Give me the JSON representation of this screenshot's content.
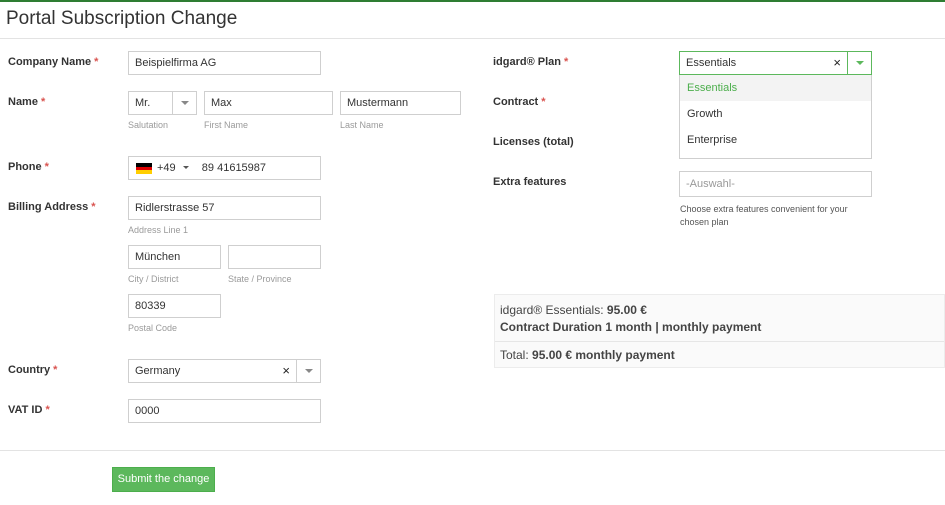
{
  "page": {
    "title": "Portal Subscription Change"
  },
  "required_marker": "*",
  "company": {
    "label": "Company Name",
    "value": "Beispielfirma AG"
  },
  "name": {
    "label": "Name",
    "salutation": "Mr.",
    "salutation_hint": "Salutation",
    "first_name": "Max",
    "first_name_hint": "First Name",
    "last_name": "Mustermann",
    "last_name_hint": "Last Name"
  },
  "phone": {
    "label": "Phone",
    "country_code": "+49",
    "number": "89 41615987"
  },
  "billing": {
    "label": "Billing Address",
    "address_line1": "Ridlerstrasse 57",
    "address_line1_hint": "Address Line 1",
    "city": "München",
    "city_hint": "City / District",
    "state": "",
    "state_hint": "State / Province",
    "postal_code": "80339",
    "postal_code_hint": "Postal Code"
  },
  "country": {
    "label": "Country",
    "value": "Germany"
  },
  "vat": {
    "label": "VAT ID",
    "value": "0000"
  },
  "plan": {
    "label": "idgard® Plan",
    "value": "Essentials",
    "options": [
      "Essentials",
      "Growth",
      "Enterprise"
    ]
  },
  "contract": {
    "label": "Contract"
  },
  "licenses": {
    "label": "Licenses (total)"
  },
  "extras": {
    "label": "Extra features",
    "placeholder": "-Auswahl-",
    "help": "Choose extra features convenient for your chosen plan"
  },
  "summary": {
    "plan_prefix": "idgard® Essentials: ",
    "plan_price": "95.00 €",
    "duration": "Contract Duration 1 month | monthly payment",
    "total_prefix": "Total: ",
    "total_value": "95.00 € monthly payment"
  },
  "submit_label": "Submit the change",
  "colors": {
    "accent_green": "#5cb85c",
    "required_red": "#d9534f",
    "option_green": "#4cae4c"
  },
  "icons": {
    "clear": "×",
    "dropdown": "caret-down-icon",
    "flag": "germany-flag-icon"
  }
}
